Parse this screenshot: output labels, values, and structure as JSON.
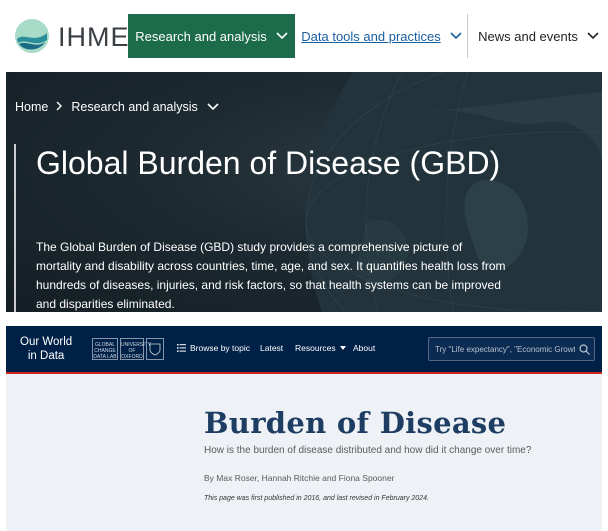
{
  "ihme": {
    "logo_text": "IHME",
    "nav": {
      "research": "Research and analysis",
      "data_tools": "Data tools and practices",
      "news": "News and events"
    },
    "breadcrumb": {
      "home": "Home",
      "section": "Research and analysis"
    },
    "title": "Global Burden of Disease (GBD)",
    "description": "The Global Burden of Disease (GBD) study provides a comprehensive picture of mortality and disability across countries, time, age, and sex. It quantifies health loss from hundreds of diseases, injuries, and risk factors, so that health systems can be improved and disparities eliminated.",
    "colors": {
      "nav_active": "#1c6b4a",
      "hero_bg": "#1d2a31",
      "link": "#1a5fa0"
    }
  },
  "owid": {
    "logo_line1": "Our World",
    "logo_line2": "in Data",
    "partners": {
      "p1": "GLOBAL CHANGE DATA LAB",
      "p2": "UNIVERSITY OF OXFORD"
    },
    "menu": {
      "browse": "Browse by topic",
      "latest": "Latest",
      "resources": "Resources",
      "about": "About"
    },
    "search_placeholder": "Try \"Life expectancy\", \"Economic Growth\"",
    "title": "Burden of Disease",
    "subtitle": "How is the burden of disease distributed and how did it change over time?",
    "byline": "By Max Roser, Hannah Ritchie and Fiona Spooner",
    "published": "This page was first published in 2016, and last revised in February 2024.",
    "colors": {
      "bar": "#002147",
      "accent": "#ce261e",
      "title": "#1d3d63",
      "page_bg": "#eef1f5"
    }
  }
}
